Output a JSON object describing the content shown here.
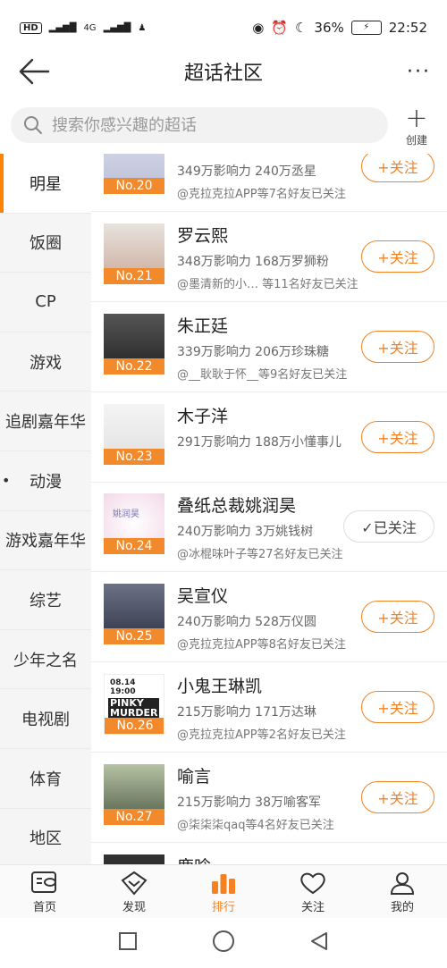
{
  "status_bar": {
    "network": "4G",
    "battery": "36%",
    "time": "22:52"
  },
  "header": {
    "title": "超话社区",
    "more": "···"
  },
  "search": {
    "placeholder": "搜索你感兴趣的超话"
  },
  "create_label": "创建",
  "categories": [
    {
      "label": "明星",
      "active": true
    },
    {
      "label": "饭圈"
    },
    {
      "label": "CP"
    },
    {
      "label": "游戏"
    },
    {
      "label": "追剧嘉年华"
    },
    {
      "label": "动漫"
    },
    {
      "label": "游戏嘉年华"
    },
    {
      "label": "综艺"
    },
    {
      "label": "少年之名"
    },
    {
      "label": "电视剧"
    },
    {
      "label": "体育"
    },
    {
      "label": "地区"
    }
  ],
  "items": [
    {
      "rank": "No.20",
      "name": "",
      "stats": "349万影响力 240万丞星",
      "friends": "@克拉克拉APP等7名好友已关注",
      "button": "+关注",
      "followed": false
    },
    {
      "rank": "No.21",
      "name": "罗云熙",
      "stats": "348万影响力 168万罗狮粉",
      "friends": "@墨清新的小…  等11名好友已关注",
      "button": "+关注",
      "followed": false
    },
    {
      "rank": "No.22",
      "name": "朱正廷",
      "stats": "339万影响力 206万珍珠糖",
      "friends": "@__耿耿于怀__等9名好友已关注",
      "button": "+关注",
      "followed": false
    },
    {
      "rank": "No.23",
      "name": "木子洋",
      "stats": "291万影响力 188万小懂事儿",
      "friends": "",
      "button": "+关注",
      "followed": false
    },
    {
      "rank": "No.24",
      "name": "叠纸总裁姚润昊",
      "stats": "240万影响力 3万姚钱树",
      "friends": "@冰棍味叶子等27名好友已关注",
      "button": "✓已关注",
      "followed": true
    },
    {
      "rank": "No.25",
      "name": "吴宣仪",
      "stats": "240万影响力 528万仪圆",
      "friends": "@克拉克拉APP等8名好友已关注",
      "button": "+关注",
      "followed": false
    },
    {
      "rank": "No.26",
      "name": "小鬼王琳凯",
      "stats": "215万影响力 171万达琳",
      "friends": "@克拉克拉APP等2名好友已关注",
      "button": "+关注",
      "followed": false
    },
    {
      "rank": "No.27",
      "name": "喻言",
      "stats": "215万影响力 38万喻客军",
      "friends": "@柒柒柒qaq等4名好友已关注",
      "button": "+关注",
      "followed": false
    },
    {
      "rank": "",
      "name": "鹿晗",
      "stats": "",
      "friends": "",
      "button": "",
      "followed": false
    }
  ],
  "thumb_text": {
    "no24": "姚润昊",
    "no26_line1": "08.14",
    "no26_line2": "19:00",
    "no26_line3": "PINKY",
    "no26_line4": "MURDER"
  },
  "tabs": [
    {
      "label": "首页",
      "icon": "home-icon"
    },
    {
      "label": "发现",
      "icon": "discover-icon"
    },
    {
      "label": "排行",
      "icon": "rank-icon",
      "active": true
    },
    {
      "label": "关注",
      "icon": "heart-icon"
    },
    {
      "label": "我的",
      "icon": "profile-icon"
    }
  ],
  "colors": {
    "accent": "#f58220",
    "rank_badge": "#f28a2c"
  }
}
